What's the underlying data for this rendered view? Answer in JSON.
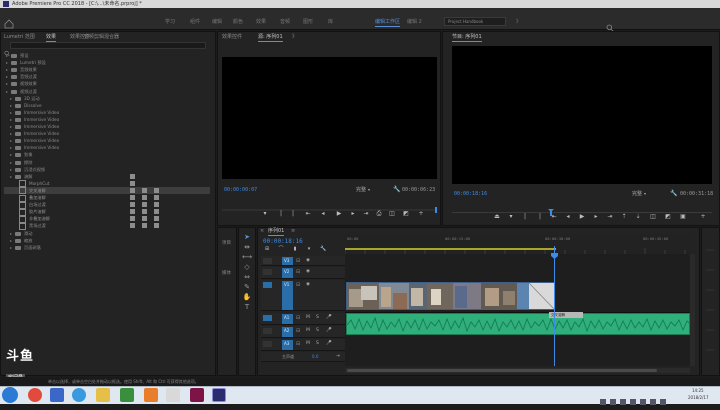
{
  "app": {
    "title": "Adobe Premiere Pro CC 2018 - [C:\\...\\未命名.prproj] *"
  },
  "workspaces": {
    "tabs": [
      "学习",
      "组件",
      "编辑",
      "颜色",
      "效果",
      "音频",
      "图形",
      "库",
      "编辑工作区",
      "编辑 2",
      "Project Handbook",
      "》"
    ],
    "active_index": 8,
    "search_placeholder": "Project Handbook"
  },
  "left_panel": {
    "tabs": [
      "Lumetri 范围",
      "效果",
      "效果控件",
      "音频剪辑混合器"
    ],
    "active_tab": 1,
    "tree": [
      {
        "label": "预设",
        "type": "folder",
        "depth": 0
      },
      {
        "label": "Lumetri 预设",
        "type": "folder",
        "depth": 0
      },
      {
        "label": "音频效果",
        "type": "folder",
        "depth": 0
      },
      {
        "label": "音频过渡",
        "type": "folder",
        "depth": 0
      },
      {
        "label": "视频效果",
        "type": "folder",
        "depth": 0
      },
      {
        "label": "视频过渡",
        "type": "folder",
        "depth": 0
      },
      {
        "label": "3D 运动",
        "type": "folder",
        "depth": 1
      },
      {
        "label": "Dissolve",
        "type": "folder",
        "depth": 1
      },
      {
        "label": "Immersive Video",
        "type": "folder",
        "depth": 1
      },
      {
        "label": "Immersive Video",
        "type": "folder",
        "depth": 1
      },
      {
        "label": "Immersive Video",
        "type": "folder",
        "depth": 1
      },
      {
        "label": "Immersive Video",
        "type": "folder",
        "depth": 1
      },
      {
        "label": "Immersive Video",
        "type": "folder",
        "depth": 1
      },
      {
        "label": "Immersive Video",
        "type": "folder",
        "depth": 1
      },
      {
        "label": "划像",
        "type": "folder",
        "depth": 1
      },
      {
        "label": "擦除",
        "type": "folder",
        "depth": 1
      },
      {
        "label": "沉浸式视频",
        "type": "folder",
        "depth": 1
      },
      {
        "label": "溶解",
        "type": "folder",
        "depth": 1
      },
      {
        "label": "MorphCut",
        "type": "fx",
        "depth": 2
      },
      {
        "label": "交叉溶解",
        "type": "fx",
        "depth": 2,
        "selected": true
      },
      {
        "label": "叠加溶解",
        "type": "fx",
        "depth": 2
      },
      {
        "label": "白场过渡",
        "type": "fx",
        "depth": 2
      },
      {
        "label": "胶片溶解",
        "type": "fx",
        "depth": 2
      },
      {
        "label": "非叠加溶解",
        "type": "fx",
        "depth": 2
      },
      {
        "label": "黑场过渡",
        "type": "fx",
        "depth": 2
      },
      {
        "label": "滑动",
        "type": "folder",
        "depth": 1
      },
      {
        "label": "缩放",
        "type": "folder",
        "depth": 1
      },
      {
        "label": "页面剥落",
        "type": "folder",
        "depth": 1
      }
    ]
  },
  "source_monitor": {
    "tabs": [
      "效果控件",
      "源: 序列01",
      "》"
    ],
    "active_tab": 1,
    "timecode_left": "00:00:00:07",
    "fit": "完整",
    "timecode_right": "00:00:06:23"
  },
  "program_monitor": {
    "tab": "节目: 序列01",
    "timecode_left": "00:00:18:16",
    "fit": "完整",
    "timecode_right": "00:00:31:18"
  },
  "project_panel": {
    "tabs": [
      "项目",
      "媒体"
    ],
    "labels": [
      "项目",
      "媒体"
    ]
  },
  "timeline": {
    "tab": "序列01",
    "timecode": "00:00:18:16",
    "ruler_labels": [
      "00:00",
      "00:00:15:00",
      "00:00:30:00",
      "00:00:45:00"
    ],
    "tracks": [
      {
        "name": "V3",
        "type": "video"
      },
      {
        "name": "V2",
        "type": "video"
      },
      {
        "name": "V1",
        "type": "video"
      },
      {
        "name": "A1",
        "type": "audio"
      },
      {
        "name": "A2",
        "type": "audio"
      },
      {
        "name": "A3",
        "type": "audio"
      },
      {
        "name": "主声道",
        "type": "master",
        "value": "0.0"
      }
    ],
    "clip_label": "交叉溶解"
  },
  "watermark": {
    "logo_text": "斗鱼",
    "sub_text": "房间号",
    "room_number": "5198639"
  },
  "status_bar": {
    "text": "单击以选择，或单击空白处并拖动以框选。使用 Shift、Alt 和 Ctrl 可获得其他选项。"
  },
  "taskbar": {
    "time": "14:25",
    "date": "2018/2/17"
  },
  "colors": {
    "accent_blue": "#3d8be8",
    "audio_green": "#2fb07a",
    "work_area_yellow": "#a9a62a",
    "track_target_blue": "#2a6ea9"
  }
}
